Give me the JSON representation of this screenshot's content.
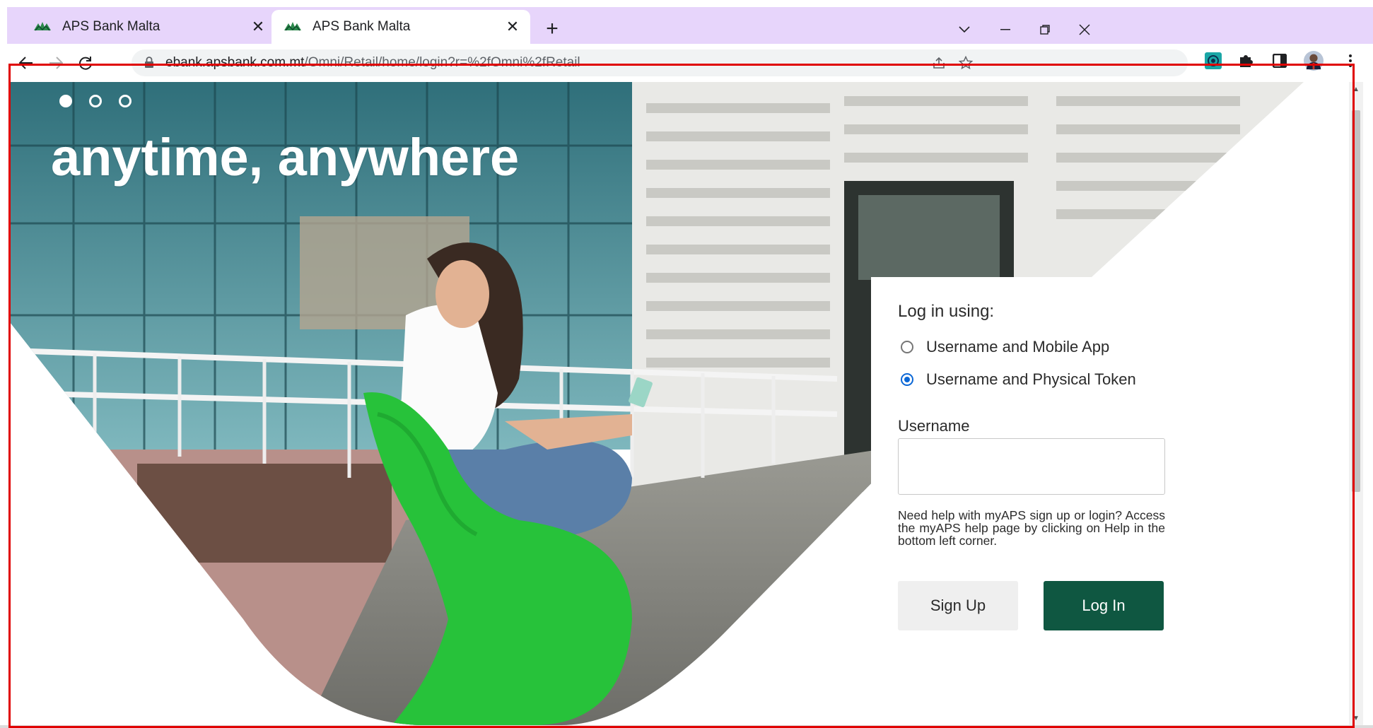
{
  "browser": {
    "tabs": [
      {
        "title": "APS Bank Malta",
        "active": false
      },
      {
        "title": "APS Bank Malta",
        "active": true
      }
    ],
    "new_tab_glyph": "+",
    "url_host": "ebank.apsbank.com.mt",
    "url_path": "/Omni/Retail/home/login?r=%2fOmni%2fRetail"
  },
  "hero": {
    "slides": 3,
    "active_slide": 1,
    "title": "anytime, anywhere"
  },
  "login": {
    "heading": "Log in using:",
    "options": [
      {
        "label": "Username and Mobile App",
        "checked": false
      },
      {
        "label": "Username and Physical Token",
        "checked": true
      }
    ],
    "username_label": "Username",
    "username_value": "",
    "help_text": "Need help with myAPS sign up or login? Access the myAPS help page by clicking on Help in the bottom left corner.",
    "signup_label": "Sign Up",
    "login_label": "Log In"
  },
  "colors": {
    "tabstrip": "#e7d5fb",
    "brand_green": "#0f5741",
    "chair_green": "#27c23a",
    "radio_blue": "#0b67d6",
    "annotation_red": "#e00000"
  },
  "icons": [
    "aps-favicon",
    "close-icon",
    "plus-icon",
    "chevron-down-icon",
    "minimize-icon",
    "restore-icon",
    "back-arrow-icon",
    "forward-arrow-icon",
    "reload-icon",
    "lock-icon",
    "share-icon",
    "star-icon",
    "extension-icon",
    "puzzle-icon",
    "sidebar-icon",
    "avatar",
    "kebab-menu-icon"
  ]
}
